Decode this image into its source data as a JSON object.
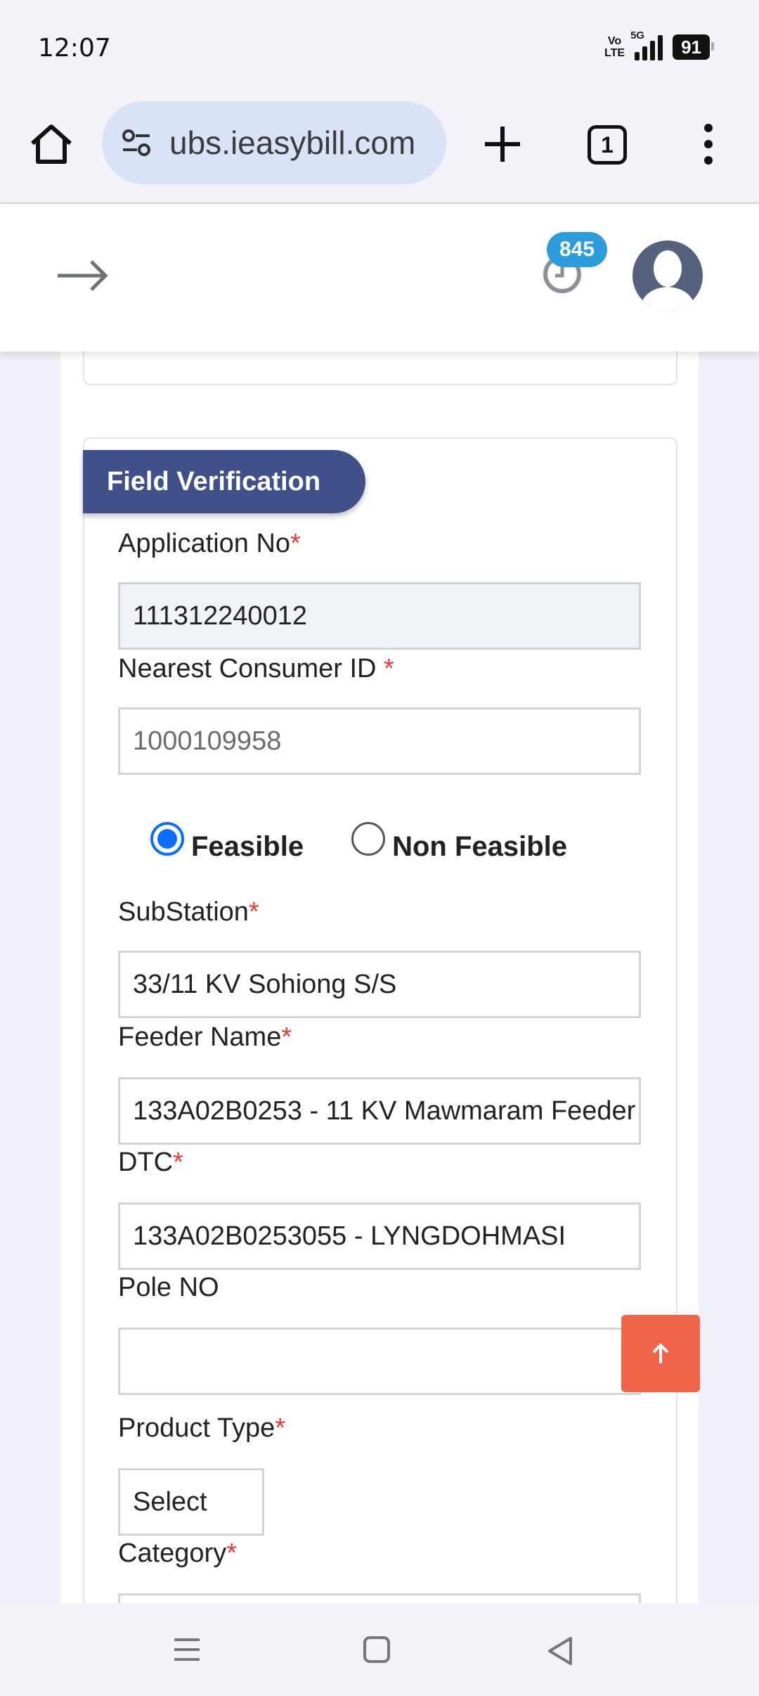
{
  "status_bar": {
    "time": "12:07",
    "volte_line1": "Vo",
    "volte_line2": "LTE",
    "network": "5G",
    "battery": "91"
  },
  "browser": {
    "url": "ubs.ieasybill.com",
    "tab_count": "1"
  },
  "app_header": {
    "notification_count": "845"
  },
  "form": {
    "section_title": "Field Verification",
    "application_no_label": "Application No",
    "application_no_value": "111312240012",
    "nearest_consumer_label": "Nearest Consumer ID ",
    "nearest_consumer_placeholder": "1000109958",
    "radio_feasible": "Feasible",
    "radio_non_feasible": "Non Feasible",
    "substation_label": "SubStation",
    "substation_value": "33/11 KV Sohiong S/S",
    "feeder_label": "Feeder Name",
    "feeder_value": "133A02B0253 - 11 KV Mawmaram Feeder",
    "dtc_label": "DTC",
    "dtc_value": "133A02B0253055 - LYNGDOHMASI",
    "pole_label": "Pole NO",
    "pole_value": "",
    "product_type_label": "Product Type",
    "product_type_value": "Select",
    "category_label": "Category",
    "required_mark": "*"
  },
  "colors": {
    "accent": "#405189",
    "required": "#e63b3b",
    "radio_checked": "#0d6efd",
    "scroll_top_button": "#f0654a",
    "badge": "#2d9cdb"
  }
}
